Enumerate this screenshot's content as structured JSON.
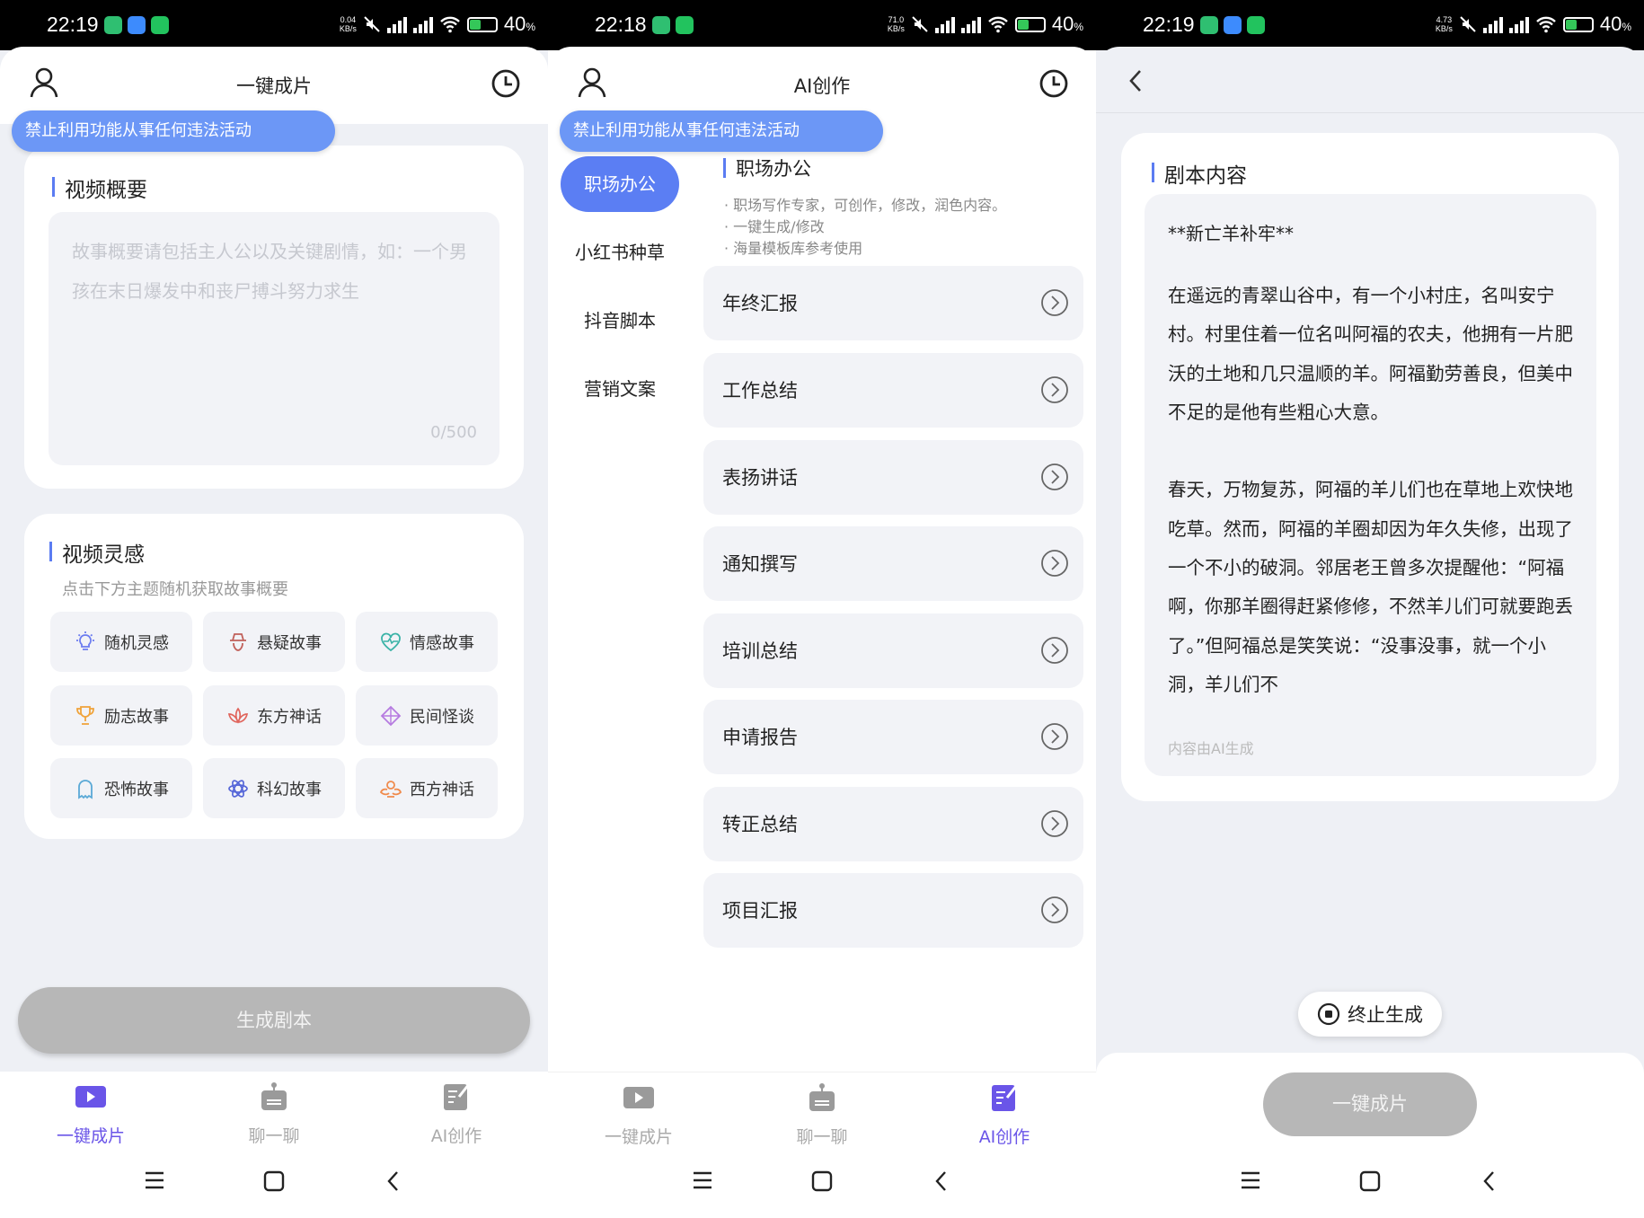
{
  "status": [
    {
      "time": "22:19",
      "speed_top": "0.04",
      "speed_bottom": "KB/s",
      "battery": "40",
      "pct_sign": "%"
    },
    {
      "time": "22:18",
      "speed_top": "71.0",
      "speed_bottom": "KB/s",
      "battery": "40",
      "pct_sign": "%"
    },
    {
      "time": "22:19",
      "speed_top": "4.73",
      "speed_bottom": "KB/s",
      "battery": "40",
      "pct_sign": "%"
    }
  ],
  "banner": "禁止利用功能从事任何违法活动",
  "tabs": [
    "一键成片",
    "聊一聊",
    "AI创作"
  ],
  "colors": {
    "accent": "#6a55e8",
    "banner": "#6c97f6",
    "sidebar_active": "#5b7ef3",
    "disabled_button": "#b7b7b7"
  },
  "screen1": {
    "title": "一键成片",
    "summary_title": "视频概要",
    "summary_placeholder": "故事概要请包括主人公以及关键剧情，如：一个男孩在末日爆发中和丧尸搏斗努力求生",
    "summary_count": "0/500",
    "inspiration_title": "视频灵感",
    "inspiration_hint": "点击下方主题随机获取故事概要",
    "chips": [
      {
        "label": "随机灵感",
        "icon": "bulb-icon"
      },
      {
        "label": "悬疑故事",
        "icon": "detective-icon"
      },
      {
        "label": "情感故事",
        "icon": "heart-icon"
      },
      {
        "label": "励志故事",
        "icon": "trophy-icon"
      },
      {
        "label": "东方神话",
        "icon": "lotus-icon"
      },
      {
        "label": "民间怪谈",
        "icon": "lantern-icon"
      },
      {
        "label": "恐怖故事",
        "icon": "ghost-icon"
      },
      {
        "label": "科幻故事",
        "icon": "atom-icon"
      },
      {
        "label": "西方神话",
        "icon": "angel-icon"
      }
    ],
    "generate_button": "生成剧本"
  },
  "screen2": {
    "title": "AI创作",
    "sidebar": [
      "职场办公",
      "小红书种草",
      "抖音脚本",
      "营销文案"
    ],
    "category_title": "职场办公",
    "category_desc": [
      "· 职场写作专家，可创作，修改，润色内容。",
      "· 一键生成/修改",
      "· 海量模板库参考使用"
    ],
    "items": [
      "年终汇报",
      "工作总结",
      "表扬讲话",
      "通知撰写",
      "培训总结",
      "申请报告",
      "转正总结",
      "项目汇报"
    ]
  },
  "screen3": {
    "section_title": "剧本内容",
    "script_heading": "**新亡羊补牢**",
    "script_body": "在遥远的青翠山谷中，有一个小村庄，名叫安宁村。村里住着一位名叫阿福的农夫，他拥有一片肥沃的土地和几只温顺的羊。阿福勤劳善良，但美中不足的是他有些粗心大意。\n\n春天，万物复苏，阿福的羊儿们也在草地上欢快地吃草。然而，阿福的羊圈却因为年久失修，出现了一个不小的破洞。邻居老王曾多次提醒他：“阿福啊，你那羊圈得赶紧修修，不然羊儿们可就要跑丢了。”但阿福总是笑笑说：“没事没事，就一个小洞，羊儿们不",
    "ai_note": "内容由AI生成",
    "stop_button": "终止生成",
    "make_button": "一键成片"
  }
}
